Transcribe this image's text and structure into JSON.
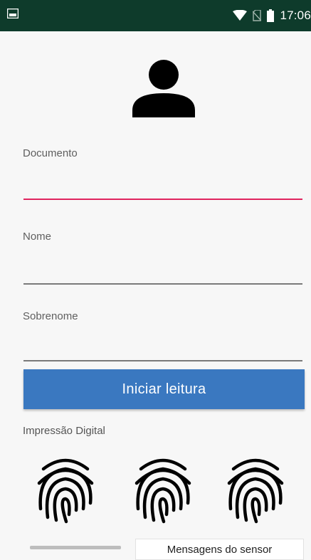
{
  "status_bar": {
    "time": "17:06",
    "icons": [
      "image-notification-icon",
      "wifi-icon",
      "no-sim-icon",
      "battery-icon"
    ]
  },
  "profile": {
    "icon": "person-icon"
  },
  "form": {
    "documento": {
      "label": "Documento",
      "value": "",
      "active": true
    },
    "nome": {
      "label": "Nome",
      "value": ""
    },
    "sobrenome": {
      "label": "Sobrenome",
      "value": ""
    }
  },
  "actions": {
    "start_reading_label": "Iniciar leitura"
  },
  "fingerprint_section": {
    "label": "Impressão Digital",
    "slots": [
      "fingerprint-icon",
      "fingerprint-icon",
      "fingerprint-icon"
    ]
  },
  "sensor": {
    "messages_label": "Mensagens do sensor",
    "progress": 0
  },
  "colors": {
    "status_bar": "#0e3b2b",
    "accent": "#e0245e",
    "button": "#3a78c0",
    "background": "#f7f7f7"
  }
}
